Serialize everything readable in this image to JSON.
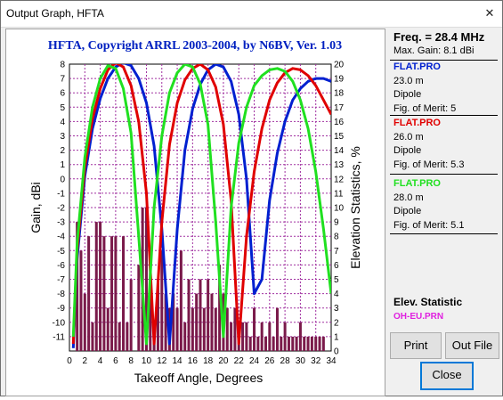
{
  "window": {
    "title": "Output Graph, HFTA",
    "close_glyph": "✕"
  },
  "chart_data": {
    "type": "line",
    "title": "HFTA, Copyright ARRL 2003-2004, by N6BV, Ver. 1.03",
    "xlabel": "Takeoff Angle, Degrees",
    "ylabel": "Gain, dBi",
    "y2label": "Elevation Statistics, %",
    "xlim": [
      0,
      34
    ],
    "ylim": [
      -12,
      8
    ],
    "y2lim": [
      0,
      20
    ],
    "x_ticks": [
      0,
      2,
      4,
      6,
      8,
      10,
      12,
      14,
      16,
      18,
      20,
      22,
      24,
      26,
      28,
      30,
      32,
      34
    ],
    "y_ticks": [
      8,
      7,
      6,
      5,
      4,
      3,
      2,
      1,
      0,
      -1,
      -2,
      -3,
      -4,
      -5,
      -6,
      -7,
      -8,
      -9,
      -10,
      -11
    ],
    "y2_ticks": [
      20,
      19,
      18,
      17,
      16,
      15,
      14,
      13,
      12,
      11,
      10,
      9,
      8,
      7,
      6,
      5,
      4,
      3,
      2,
      1,
      0
    ],
    "grid": true,
    "series": [
      {
        "name": "FLAT.PRO",
        "color": "#0020d0",
        "x": [
          0.5,
          1,
          2,
          3,
          4,
          5,
          6,
          7,
          8,
          9,
          10,
          11,
          12,
          13,
          14,
          15,
          16,
          17,
          18,
          19,
          20,
          21,
          22,
          23,
          24,
          25,
          26,
          27,
          28,
          29,
          30,
          31,
          32,
          33,
          34
        ],
        "y": [
          -11.8,
          -5.6,
          0.2,
          3.5,
          5.6,
          7.0,
          7.8,
          8.1,
          7.9,
          7.0,
          5.3,
          2.3,
          -3.5,
          -11.5,
          -3.5,
          2.0,
          4.9,
          6.6,
          7.6,
          8.0,
          7.8,
          6.8,
          4.5,
          0.0,
          -8.0,
          -7.0,
          -1.5,
          1.8,
          4.0,
          5.5,
          6.3,
          6.8,
          7.0,
          7.0,
          6.8
        ]
      },
      {
        "name": "FLAT.PRO",
        "color": "#e00000",
        "x": [
          0.5,
          1,
          2,
          3,
          4,
          5,
          6,
          7,
          8,
          9,
          10,
          11,
          12,
          13,
          14,
          15,
          16,
          17,
          18,
          19,
          20,
          21,
          22,
          23,
          24,
          25,
          26,
          27,
          28,
          29,
          30,
          31,
          32,
          33,
          34
        ],
        "y": [
          -11.5,
          -5.0,
          0.8,
          4.2,
          6.3,
          7.6,
          8.1,
          7.8,
          6.5,
          4.0,
          -1.0,
          -11.5,
          -3.0,
          2.4,
          5.3,
          6.9,
          7.7,
          8.0,
          7.6,
          6.4,
          3.8,
          -1.5,
          -11.5,
          -4.0,
          0.5,
          3.5,
          5.5,
          6.7,
          7.4,
          7.7,
          7.6,
          7.2,
          6.5,
          5.5,
          4.5
        ]
      },
      {
        "name": "FLAT.PRO",
        "color": "#20e020",
        "x": [
          0.5,
          1,
          2,
          3,
          4,
          5,
          6,
          7,
          8,
          9,
          10,
          11,
          12,
          13,
          14,
          15,
          16,
          17,
          18,
          19,
          20,
          21,
          22,
          23,
          24,
          25,
          26,
          27,
          28,
          29,
          30,
          31,
          32,
          33,
          34
        ],
        "y": [
          -11.0,
          -4.5,
          1.5,
          5.0,
          7.0,
          7.9,
          7.7,
          6.3,
          3.2,
          -4.0,
          -11.5,
          -2.0,
          3.0,
          6.0,
          7.4,
          8.0,
          7.8,
          6.6,
          3.8,
          -3.0,
          -11.0,
          -2.0,
          2.5,
          5.0,
          6.5,
          7.2,
          7.6,
          7.7,
          7.5,
          6.8,
          5.5,
          3.5,
          0.5,
          -3.5,
          -8.0
        ]
      }
    ],
    "stats_bars": {
      "name": "OH-EU.PRN",
      "x": [
        1,
        1.5,
        2,
        2.5,
        3,
        3.5,
        4,
        4.5,
        5,
        5.5,
        6,
        6.5,
        7,
        7.5,
        8,
        9,
        9.5,
        10,
        10.5,
        11,
        11.5,
        12,
        12.5,
        13,
        13.5,
        14,
        14.5,
        15,
        15.5,
        16,
        16.5,
        17,
        17.5,
        18,
        18.5,
        19,
        19.5,
        20,
        20.5,
        21,
        21.5,
        22,
        22.5,
        23,
        23.5,
        24,
        24.5,
        25,
        25.5,
        26,
        26.5,
        27,
        27.5,
        28,
        28.5,
        29,
        29.5,
        30,
        30.5,
        31,
        31.5,
        32,
        32.5,
        33
      ],
      "values": [
        9,
        7,
        4,
        8,
        2,
        9,
        9,
        8,
        3,
        8,
        8,
        2,
        8,
        2,
        5,
        6,
        10,
        10,
        6,
        2,
        5,
        7,
        4,
        3,
        4,
        3,
        7,
        2,
        5,
        3,
        4,
        5,
        3,
        5,
        4,
        3,
        6,
        4,
        3,
        2,
        3,
        1,
        2,
        2,
        1,
        3,
        1,
        2,
        1,
        2,
        1,
        3,
        1,
        2,
        1,
        1,
        1,
        2,
        1,
        1,
        1,
        1,
        1,
        1
      ]
    }
  },
  "panel": {
    "freq": "Freq. = 28.4 MHz",
    "max_gain": "Max. Gain: 8.1 dBi",
    "blocks": [
      {
        "file": "FLAT.PRO",
        "color": "#0020d0",
        "height": "23.0 m",
        "type": "Dipole",
        "fom": "Fig. of Merit:  5"
      },
      {
        "file": "FLAT.PRO",
        "color": "#e00000",
        "height": "26.0 m",
        "type": "Dipole",
        "fom": "Fig. of Merit:  5.3"
      },
      {
        "file": "FLAT.PRO",
        "color": "#20e020",
        "height": "28.0 m",
        "type": "Dipole",
        "fom": "Fig. of Merit:  5.1"
      }
    ],
    "elev_title": "Elev. Statistic",
    "elev_file": "OH-EU.PRN",
    "print_label": "Print",
    "outfile_label": "Out File",
    "close_label": "Close"
  }
}
